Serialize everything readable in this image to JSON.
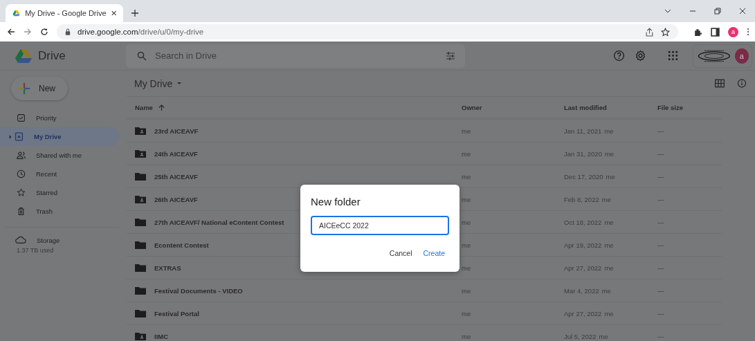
{
  "browser": {
    "tab_title": "My Drive - Google Drive",
    "url_host": "drive.google.com",
    "url_path": "/drive/u/0/my-drive",
    "profile_initial": "a"
  },
  "header": {
    "app_name": "Drive",
    "search_placeholder": "Search in Drive",
    "avatar_initial": "a"
  },
  "sidebar": {
    "new_label": "New",
    "items": [
      {
        "label": "Priority",
        "selected": false
      },
      {
        "label": "My Drive",
        "selected": true
      },
      {
        "label": "Shared with me",
        "selected": false
      },
      {
        "label": "Recent",
        "selected": false
      },
      {
        "label": "Starred",
        "selected": false
      },
      {
        "label": "Trash",
        "selected": false
      }
    ],
    "storage_label": "Storage",
    "storage_used": "1.37 TB used"
  },
  "main": {
    "title": "My Drive",
    "columns": [
      "Name",
      "Owner",
      "Last modified",
      "File size"
    ],
    "rows": [
      {
        "name": "23rd AICEAVF",
        "kind": "shared",
        "owner": "me",
        "modified": "Jan 11, 2021",
        "modified_by": "me",
        "size": "—"
      },
      {
        "name": "24th AICEAVF",
        "kind": "shared",
        "owner": "me",
        "modified": "Jan 31, 2020",
        "modified_by": "me",
        "size": "—"
      },
      {
        "name": "25th AICEAVF",
        "kind": "folder",
        "owner": "me",
        "modified": "Dec 17, 2020",
        "modified_by": "me",
        "size": "—"
      },
      {
        "name": "26th AICEAVF",
        "kind": "shared",
        "owner": "me",
        "modified": "Feb 8, 2022",
        "modified_by": "me",
        "size": "—"
      },
      {
        "name": "27th AICEAVF/ National eContent Contest",
        "kind": "folder",
        "owner": "me",
        "modified": "Oct 18, 2022",
        "modified_by": "me",
        "size": "—"
      },
      {
        "name": "Econtent Contest",
        "kind": "folder",
        "owner": "me",
        "modified": "Apr 19, 2022",
        "modified_by": "me",
        "size": "—"
      },
      {
        "name": "EXTRAS",
        "kind": "folder",
        "owner": "me",
        "modified": "Apr 27, 2022",
        "modified_by": "me",
        "size": "—"
      },
      {
        "name": "Festival Documents - VIDEO",
        "kind": "folder",
        "owner": "me",
        "modified": "Mar 4, 2022",
        "modified_by": "me",
        "size": "—"
      },
      {
        "name": "Festival Portal",
        "kind": "folder",
        "owner": "me",
        "modified": "Apr 27, 2022",
        "modified_by": "me",
        "size": "—"
      },
      {
        "name": "IIMC",
        "kind": "shared",
        "owner": "me",
        "modified": "Jul 5, 2022",
        "modified_by": "me",
        "size": "—"
      }
    ]
  },
  "dialog": {
    "title": "New folder",
    "value": "AICEeCC 2022",
    "buttons": [
      "Cancel",
      "Create"
    ]
  }
}
